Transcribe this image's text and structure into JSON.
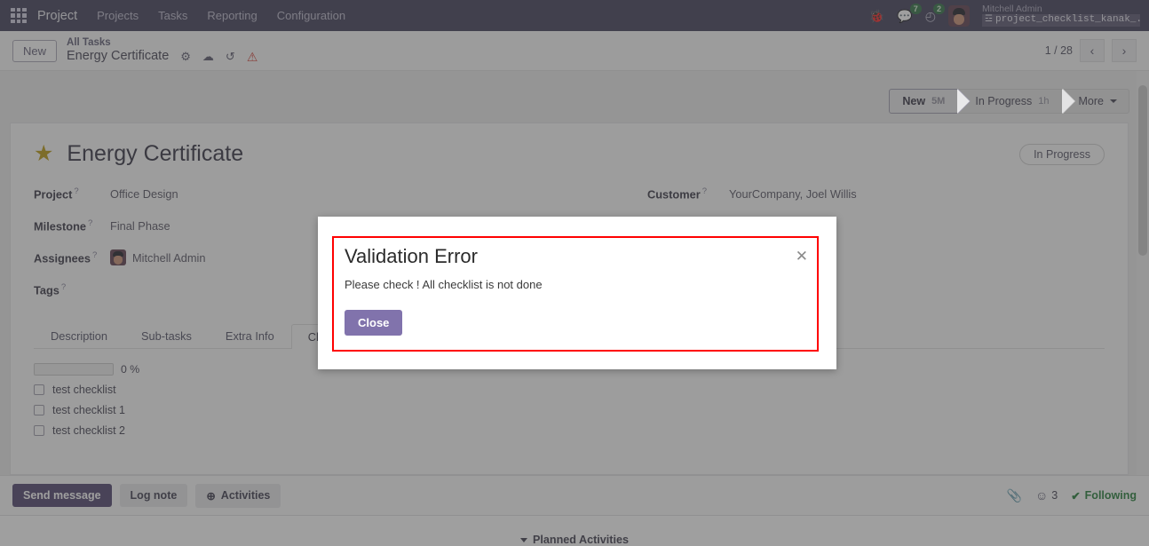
{
  "navbar": {
    "apps_icon": "grid-apps-icon",
    "brand": "Project",
    "items": [
      {
        "label": "Projects"
      },
      {
        "label": "Tasks"
      },
      {
        "label": "Reporting"
      },
      {
        "label": "Configuration"
      }
    ],
    "bug_icon": "🐞",
    "messages_icon": "💬",
    "messages_count": "7",
    "activities_icon": "◴",
    "activities_count": "2",
    "user_name": "Mitchell Admin",
    "db_icon": "☲",
    "db_name": "project_checklist_kanak_..."
  },
  "control_panel": {
    "new_button": "New",
    "breadcrumb_parent": "All Tasks",
    "breadcrumb_record": "Energy Certificate",
    "gear_icon": "⚙",
    "cloud_icon": "☁",
    "undo_icon": "↺",
    "alert_icon": "⚠",
    "pager_text": "1 / 28",
    "prev_icon": "‹",
    "next_icon": "›"
  },
  "statusbar": {
    "stages": [
      {
        "label": "New",
        "duration": "5M",
        "active": true
      },
      {
        "label": "In Progress",
        "duration": "1h",
        "active": false
      }
    ],
    "more_label": "More"
  },
  "form": {
    "star_icon": "★",
    "title": "Energy Certificate",
    "ribbon": "In Progress",
    "left_fields": [
      {
        "label": "Project",
        "value": "Office Design",
        "help": "?"
      },
      {
        "label": "Milestone",
        "value": "Final Phase",
        "help": "?"
      },
      {
        "label": "Assignees",
        "value": "Mitchell Admin",
        "help": "?",
        "avatar": true
      },
      {
        "label": "Tags",
        "value": "",
        "help": "?"
      }
    ],
    "right_fields": [
      {
        "label": "Customer",
        "value": "YourCompany, Joel Willis",
        "help": "?"
      }
    ]
  },
  "notebook": {
    "tabs": [
      {
        "label": "Description",
        "active": false
      },
      {
        "label": "Sub-tasks",
        "active": false
      },
      {
        "label": "Extra Info",
        "active": false
      },
      {
        "label": "Checklist",
        "active": true
      }
    ],
    "checklist": {
      "progress_label": "0 %",
      "progress_value": 0,
      "items": [
        {
          "label": "test checklist",
          "checked": false
        },
        {
          "label": "test checklist 1",
          "checked": false
        },
        {
          "label": "test checklist 2",
          "checked": false
        }
      ]
    }
  },
  "chatter": {
    "send_message": "Send message",
    "log_note": "Log note",
    "activities": "Activities",
    "activities_icon": "⊕",
    "attachment_icon": "📎",
    "followers_icon": "☺",
    "followers_count": "3",
    "following_icon": "✔",
    "following_label": "Following",
    "planned_activities": "Planned Activities"
  },
  "modal": {
    "title": "Validation Error",
    "message": "Please check ! All checklist is not done",
    "close_button": "Close",
    "close_icon": "✕",
    "highlight_color": "#ff0000",
    "button_color": "#8173ac"
  }
}
